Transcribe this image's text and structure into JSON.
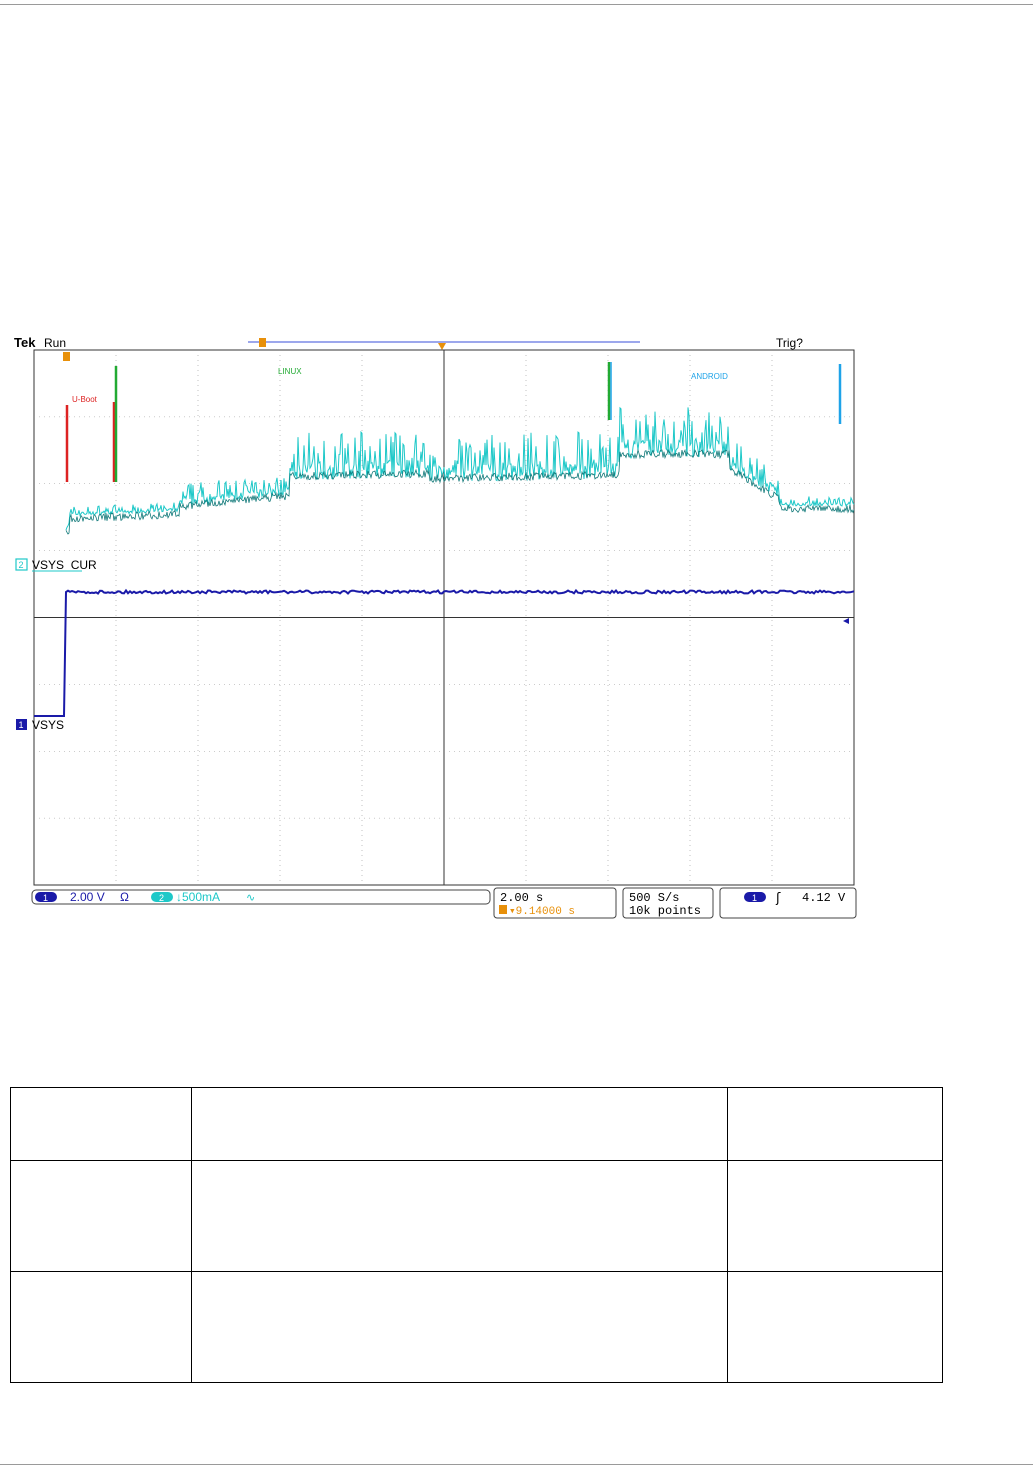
{
  "scope": {
    "brand": "Tek",
    "run_state": "Run",
    "trigger_state": "Trig?",
    "markers": [
      {
        "label": "U-Boot",
        "color": "#dd2222"
      },
      {
        "label": "LINUX",
        "color": "#22aa33"
      },
      {
        "label": "ANDROID",
        "color": "#1ea3e8"
      }
    ],
    "channels": [
      {
        "id": "2",
        "name": "VSYS_CUR",
        "color": "#1ec8c8"
      },
      {
        "id": "1",
        "name": "VSYS",
        "color": "#1a1aa8"
      }
    ],
    "status": {
      "ch1_number": "1",
      "ch1_scale": "2.00 V",
      "ch1_coupling": "Ω",
      "ch2_number": "2",
      "ch2_scale": "↓500mA",
      "ch2_coupling": "∿",
      "timebase": "2.00 s",
      "trigger_position": "▾9.14000 s",
      "sample_rate": "500 S/s",
      "record_length": "10k points",
      "trigger_source": "1",
      "trigger_slope": "ʃ",
      "trigger_level": "4.12 V"
    },
    "colors": {
      "grid": "#333333",
      "accent_orange": "#e8900a",
      "ch1": "#1a1aa8",
      "ch2": "#1ec8c8",
      "ch2_dark": "#0f7878"
    }
  },
  "table": {
    "headers": [
      "",
      "",
      ""
    ],
    "rows": [
      [
        "",
        "",
        ""
      ],
      [
        "",
        "",
        ""
      ]
    ]
  }
}
